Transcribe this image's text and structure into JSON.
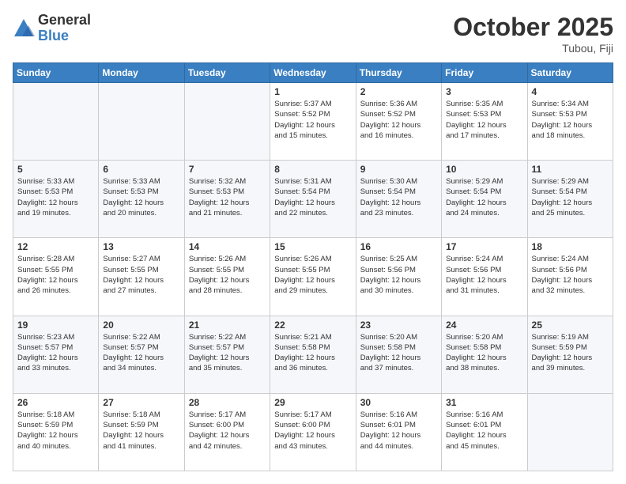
{
  "logo": {
    "general": "General",
    "blue": "Blue"
  },
  "header": {
    "month": "October 2025",
    "location": "Tubou, Fiji"
  },
  "weekdays": [
    "Sunday",
    "Monday",
    "Tuesday",
    "Wednesday",
    "Thursday",
    "Friday",
    "Saturday"
  ],
  "weeks": [
    [
      {
        "day": "",
        "info": ""
      },
      {
        "day": "",
        "info": ""
      },
      {
        "day": "",
        "info": ""
      },
      {
        "day": "1",
        "info": "Sunrise: 5:37 AM\nSunset: 5:52 PM\nDaylight: 12 hours\nand 15 minutes."
      },
      {
        "day": "2",
        "info": "Sunrise: 5:36 AM\nSunset: 5:52 PM\nDaylight: 12 hours\nand 16 minutes."
      },
      {
        "day": "3",
        "info": "Sunrise: 5:35 AM\nSunset: 5:53 PM\nDaylight: 12 hours\nand 17 minutes."
      },
      {
        "day": "4",
        "info": "Sunrise: 5:34 AM\nSunset: 5:53 PM\nDaylight: 12 hours\nand 18 minutes."
      }
    ],
    [
      {
        "day": "5",
        "info": "Sunrise: 5:33 AM\nSunset: 5:53 PM\nDaylight: 12 hours\nand 19 minutes."
      },
      {
        "day": "6",
        "info": "Sunrise: 5:33 AM\nSunset: 5:53 PM\nDaylight: 12 hours\nand 20 minutes."
      },
      {
        "day": "7",
        "info": "Sunrise: 5:32 AM\nSunset: 5:53 PM\nDaylight: 12 hours\nand 21 minutes."
      },
      {
        "day": "8",
        "info": "Sunrise: 5:31 AM\nSunset: 5:54 PM\nDaylight: 12 hours\nand 22 minutes."
      },
      {
        "day": "9",
        "info": "Sunrise: 5:30 AM\nSunset: 5:54 PM\nDaylight: 12 hours\nand 23 minutes."
      },
      {
        "day": "10",
        "info": "Sunrise: 5:29 AM\nSunset: 5:54 PM\nDaylight: 12 hours\nand 24 minutes."
      },
      {
        "day": "11",
        "info": "Sunrise: 5:29 AM\nSunset: 5:54 PM\nDaylight: 12 hours\nand 25 minutes."
      }
    ],
    [
      {
        "day": "12",
        "info": "Sunrise: 5:28 AM\nSunset: 5:55 PM\nDaylight: 12 hours\nand 26 minutes."
      },
      {
        "day": "13",
        "info": "Sunrise: 5:27 AM\nSunset: 5:55 PM\nDaylight: 12 hours\nand 27 minutes."
      },
      {
        "day": "14",
        "info": "Sunrise: 5:26 AM\nSunset: 5:55 PM\nDaylight: 12 hours\nand 28 minutes."
      },
      {
        "day": "15",
        "info": "Sunrise: 5:26 AM\nSunset: 5:55 PM\nDaylight: 12 hours\nand 29 minutes."
      },
      {
        "day": "16",
        "info": "Sunrise: 5:25 AM\nSunset: 5:56 PM\nDaylight: 12 hours\nand 30 minutes."
      },
      {
        "day": "17",
        "info": "Sunrise: 5:24 AM\nSunset: 5:56 PM\nDaylight: 12 hours\nand 31 minutes."
      },
      {
        "day": "18",
        "info": "Sunrise: 5:24 AM\nSunset: 5:56 PM\nDaylight: 12 hours\nand 32 minutes."
      }
    ],
    [
      {
        "day": "19",
        "info": "Sunrise: 5:23 AM\nSunset: 5:57 PM\nDaylight: 12 hours\nand 33 minutes."
      },
      {
        "day": "20",
        "info": "Sunrise: 5:22 AM\nSunset: 5:57 PM\nDaylight: 12 hours\nand 34 minutes."
      },
      {
        "day": "21",
        "info": "Sunrise: 5:22 AM\nSunset: 5:57 PM\nDaylight: 12 hours\nand 35 minutes."
      },
      {
        "day": "22",
        "info": "Sunrise: 5:21 AM\nSunset: 5:58 PM\nDaylight: 12 hours\nand 36 minutes."
      },
      {
        "day": "23",
        "info": "Sunrise: 5:20 AM\nSunset: 5:58 PM\nDaylight: 12 hours\nand 37 minutes."
      },
      {
        "day": "24",
        "info": "Sunrise: 5:20 AM\nSunset: 5:58 PM\nDaylight: 12 hours\nand 38 minutes."
      },
      {
        "day": "25",
        "info": "Sunrise: 5:19 AM\nSunset: 5:59 PM\nDaylight: 12 hours\nand 39 minutes."
      }
    ],
    [
      {
        "day": "26",
        "info": "Sunrise: 5:18 AM\nSunset: 5:59 PM\nDaylight: 12 hours\nand 40 minutes."
      },
      {
        "day": "27",
        "info": "Sunrise: 5:18 AM\nSunset: 5:59 PM\nDaylight: 12 hours\nand 41 minutes."
      },
      {
        "day": "28",
        "info": "Sunrise: 5:17 AM\nSunset: 6:00 PM\nDaylight: 12 hours\nand 42 minutes."
      },
      {
        "day": "29",
        "info": "Sunrise: 5:17 AM\nSunset: 6:00 PM\nDaylight: 12 hours\nand 43 minutes."
      },
      {
        "day": "30",
        "info": "Sunrise: 5:16 AM\nSunset: 6:01 PM\nDaylight: 12 hours\nand 44 minutes."
      },
      {
        "day": "31",
        "info": "Sunrise: 5:16 AM\nSunset: 6:01 PM\nDaylight: 12 hours\nand 45 minutes."
      },
      {
        "day": "",
        "info": ""
      }
    ]
  ]
}
